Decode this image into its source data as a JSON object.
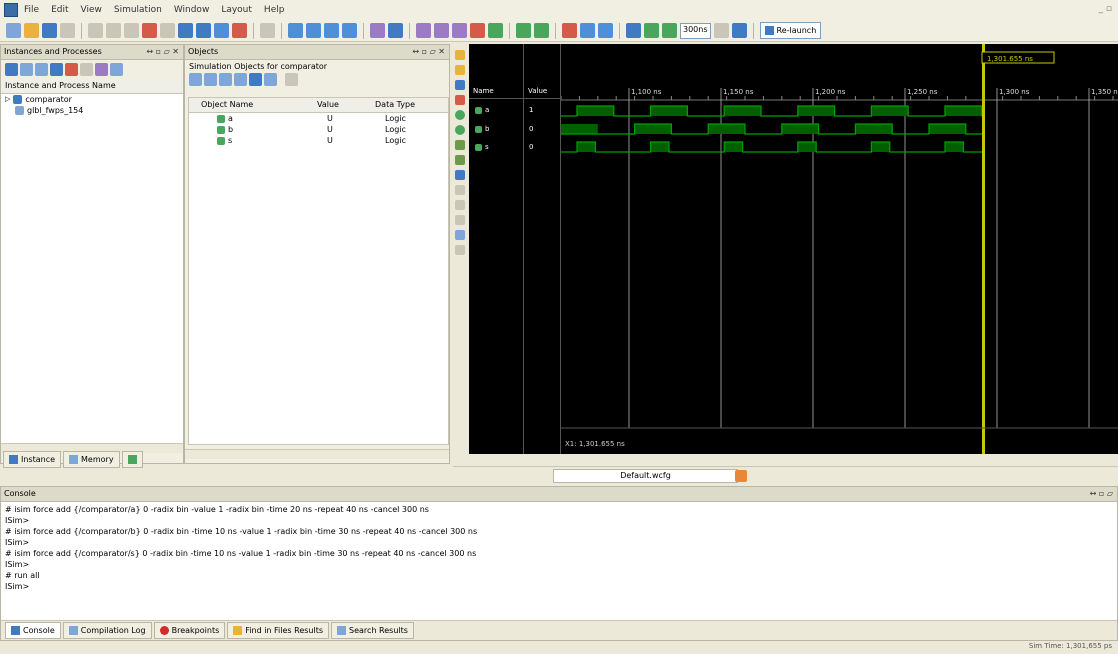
{
  "menu": {
    "items": [
      "File",
      "Edit",
      "View",
      "Simulation",
      "Window",
      "Layout",
      "Help"
    ]
  },
  "toolbar": {
    "run_time": "300ns",
    "relaunch_label": "Re-launch"
  },
  "instances_panel": {
    "title": "Instances and Processes",
    "column_header": "Instance and Process Name",
    "items": [
      {
        "label": "comparator"
      },
      {
        "label": "glbl_fwps_154"
      }
    ],
    "bottom_tabs": [
      "Instance",
      "Memory"
    ]
  },
  "objects_panel": {
    "title": "Objects",
    "subtitle": "Simulation Objects for comparator",
    "columns": [
      "Object Name",
      "Value",
      "Data Type"
    ],
    "rows": [
      {
        "name": "a",
        "value": "U",
        "type": "Logic"
      },
      {
        "name": "b",
        "value": "U",
        "type": "Logic"
      },
      {
        "name": "s",
        "value": "U",
        "type": "Logic"
      }
    ]
  },
  "wave": {
    "name_header": "Name",
    "value_header": "Value",
    "signals": [
      {
        "name": "a",
        "value": "1"
      },
      {
        "name": "b",
        "value": "0"
      },
      {
        "name": "s",
        "value": "0"
      }
    ],
    "cursor_label": "1,301.655 ns",
    "time_labels": [
      "1,100 ns",
      "1,150 ns",
      "1,200 ns",
      "1,250 ns",
      "1,300 ns",
      "1,350 ns"
    ],
    "status_text": "X1: 1,301.655 ns",
    "tab_label": "Default.wcfg"
  },
  "console": {
    "title": "Console",
    "lines": [
      "# isim force add {/comparator/a} 0 -radix bin -value 1 -radix bin -time 20 ns -repeat 40 ns -cancel 300 ns",
      "ISim>",
      "# isim force add {/comparator/b} 0 -radix bin -time 10 ns -value 1 -radix bin -time 30 ns -repeat 40 ns -cancel 300 ns",
      "ISim>",
      "# isim force add {/comparator/s} 0 -radix bin -time 10 ns -value 1 -radix bin -time 30 ns -repeat 40 ns -cancel 300 ns",
      "ISim>",
      "# run all",
      "ISim>"
    ],
    "tabs": [
      "Console",
      "Compilation Log",
      "Breakpoints",
      "Find in Files Results",
      "Search Results"
    ]
  },
  "status_bar": {
    "right_text": "Sim Time: 1,301,655 ps"
  },
  "colors": {
    "wave_bg": "#000000",
    "wave_signal": "#00a000",
    "cursor": "#c8c800"
  }
}
